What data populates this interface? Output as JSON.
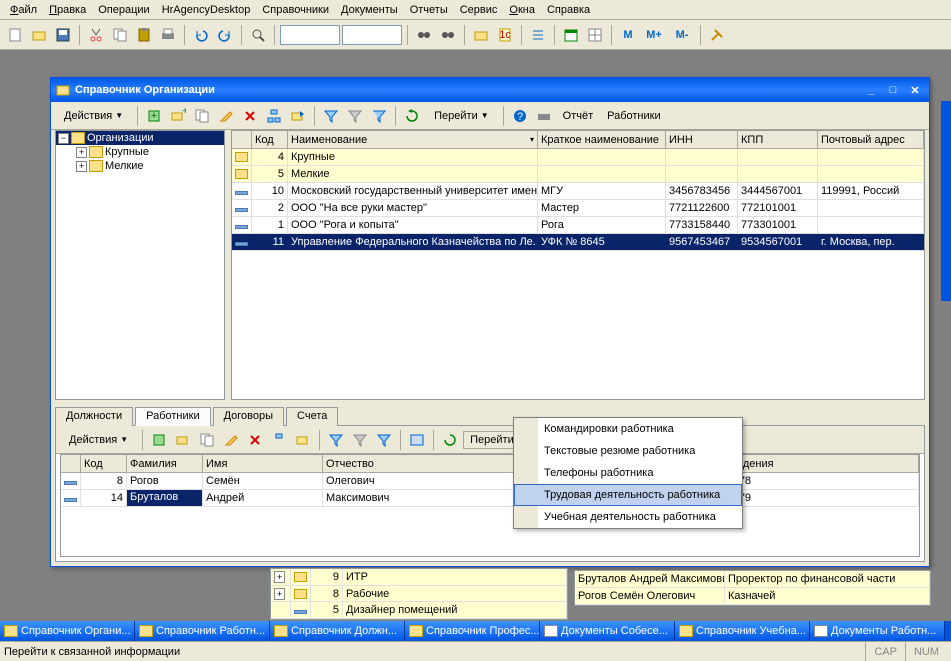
{
  "menu": {
    "file": "Файл",
    "edit": "Правка",
    "ops": "Операции",
    "hr": "HrAgencyDesktop",
    "refs": "Справочники",
    "docs": "Документы",
    "reports": "Отчеты",
    "service": "Сервис",
    "windows": "Окна",
    "help": "Справка"
  },
  "toolbar_letters": {
    "m": "M",
    "mp": "M+",
    "mm": "M-"
  },
  "window": {
    "title": "Справочник Организации",
    "actions": "Действия",
    "goto": "Перейти",
    "report": "Отчёт",
    "employees": "Работники"
  },
  "tree": {
    "root": "Организации",
    "big": "Крупные",
    "small": "Мелкие"
  },
  "grid": {
    "cols": {
      "code": "Код",
      "name": "Наименование",
      "short": "Краткое наименование",
      "inn": "ИНН",
      "kpp": "КПП",
      "addr": "Почтовый адрес"
    },
    "rows": [
      {
        "type": "folder",
        "code": "4",
        "name": "Крупные",
        "short": "",
        "inn": "",
        "kpp": "",
        "addr": ""
      },
      {
        "type": "folder",
        "code": "5",
        "name": "Мелкие",
        "short": "",
        "inn": "",
        "kpp": "",
        "addr": ""
      },
      {
        "type": "item",
        "code": "10",
        "name": "Московский государственный университет имен...",
        "short": "МГУ",
        "inn": "3456783456",
        "kpp": "3444567001",
        "addr": "119991, Россий"
      },
      {
        "type": "item",
        "code": "2",
        "name": "ООО \"На все руки мастер\"",
        "short": "Мастер",
        "inn": "7721122600",
        "kpp": "772101001",
        "addr": ""
      },
      {
        "type": "item",
        "code": "1",
        "name": "ООО \"Рога и копыта\"",
        "short": "Рога",
        "inn": "7733158440",
        "kpp": "773301001",
        "addr": ""
      },
      {
        "type": "item",
        "sel": true,
        "code": "11",
        "name": "Управление Федерального Казначейства по Ле...",
        "short": "УФК № 8645",
        "inn": "9567453467",
        "kpp": "9534567001",
        "addr": "г. Москва, пер."
      }
    ]
  },
  "tabs": {
    "positions": "Должности",
    "employees": "Работники",
    "contracts": "Договоры",
    "accounts": "Счета"
  },
  "subgrid": {
    "cols": {
      "code": "Код",
      "lname": "Фамилия",
      "fname": "Имя",
      "mname": "Отчество",
      "dob": "Дата рождения"
    },
    "rows": [
      {
        "code": "8",
        "lname": "Рогов",
        "fname": "Семён",
        "mname": "Олегович",
        "dob": "10.06.1978"
      },
      {
        "sel": true,
        "code": "14",
        "lname": "Бруталов",
        "fname": "Андрей",
        "mname": "Максимович",
        "dob": "05.05.1979"
      }
    ]
  },
  "context_menu": [
    "Командировки работника",
    "Текстовые резюме работника",
    "Телефоны работника",
    "Трудовая деятельность работника",
    "Учебная деятельность работника"
  ],
  "bg_rows": {
    "left": [
      {
        "code": "9",
        "name": "ИТР"
      },
      {
        "code": "8",
        "name": "Рабочие"
      },
      {
        "code": "5",
        "name": "Дизайнер помещений"
      }
    ],
    "right": [
      {
        "name": "Бруталов Андрей Максимови",
        "pos": "Проректор по финансовой части"
      },
      {
        "name": "Рогов Семён Олегович",
        "pos": "Казначей"
      }
    ]
  },
  "taskbar": [
    "Справочник Органи...",
    "Справочник Работн...",
    "Справочник Должн...",
    "Справочник Профес...",
    "Документы Собесе...",
    "Справочник Учебна...",
    "Документы Работн..."
  ],
  "status": {
    "text": "Перейти к связанной информации",
    "cap": "CAP",
    "num": "NUM"
  }
}
